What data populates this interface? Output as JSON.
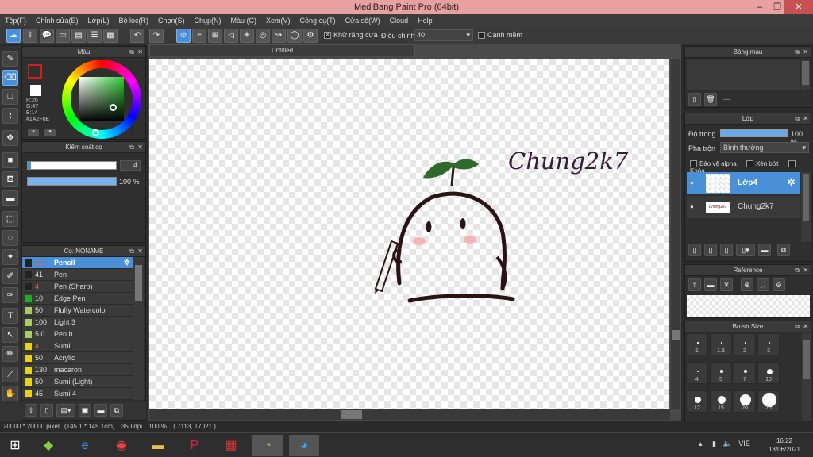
{
  "window": {
    "title": "MediBang Paint Pro (64bit)",
    "minimize": "‒",
    "maximize": "❐",
    "close": "✕"
  },
  "menu": [
    "Tệp(F)",
    "Chỉnh sửa(E)",
    "Lớp(L)",
    "Bộ lọc(R)",
    "Chọn(S)",
    "Chụp(N)",
    "Màu (C)",
    "Xem(V)",
    "Công cụ(T)",
    "Cửa sổ(W)",
    "Cloud",
    "Help"
  ],
  "toolbar": {
    "antialias_label": "Khử răng cưa",
    "adjust_label": "Điều chỉnh",
    "adjust_value": "40",
    "soft_edge_label": "Cạnh mềm"
  },
  "color_panel": {
    "title": "Màu",
    "r": "R:26",
    "g": "G:47",
    "b": "B:14",
    "hex": "#1A2F0E"
  },
  "brush_control": {
    "title": "Kiểm soát cọ",
    "size_value": "4",
    "opacity_value": "100 %"
  },
  "brush_list": {
    "title": "Cọ: NONAME",
    "items": [
      {
        "size": "12",
        "name": "Pencil",
        "color": "#222222",
        "selected": true
      },
      {
        "size": "41",
        "name": "Pen",
        "color": "#222222"
      },
      {
        "size": "4",
        "name": "Pen (Sharp)",
        "color": "#222222"
      },
      {
        "size": "10",
        "name": "Edge Pen",
        "color": "#22aa22"
      },
      {
        "size": "50",
        "name": "Fluffy Watercolor",
        "color": "#aacc66"
      },
      {
        "size": "100",
        "name": "Light 3",
        "color": "#aacc66"
      },
      {
        "size": "5.0",
        "name": " Pen b",
        "color": "#aacc66"
      },
      {
        "size": "4",
        "name": "Sumi",
        "color": "#e8d020"
      },
      {
        "size": "50",
        "name": "Acrylic",
        "color": "#e8d020"
      },
      {
        "size": "130",
        "name": "macaron",
        "color": "#e8d020"
      },
      {
        "size": "50",
        "name": "Sumi (Light)",
        "color": "#e8d020"
      },
      {
        "size": "45",
        "name": "Sumi 4",
        "color": "#e8d020"
      }
    ]
  },
  "document": {
    "tab": "Untitled",
    "signature": "Chung2k7"
  },
  "palette_panel": {
    "title": "Bảng màu",
    "dash": "---"
  },
  "layer_panel": {
    "title": "Lớp",
    "opacity_label": "Độ trong",
    "opacity_value": "100 %",
    "blend_label": "Pha trộn",
    "blend_value": "Bình thường",
    "protect_alpha": "Bảo vệ alpha",
    "clip": "Xén bớt",
    "lock": "Khóa",
    "layers": [
      {
        "name": "Lớp4",
        "selected": true
      },
      {
        "name": "Chung2k7",
        "thumb_text": "Chung2k7"
      }
    ]
  },
  "reference_panel": {
    "title": "Reference"
  },
  "brush_size_panel": {
    "title": "Brush Size",
    "sizes": [
      "1",
      "1.5",
      "2",
      "3",
      "4",
      "5",
      "7",
      "10",
      "12",
      "15",
      "20",
      "25"
    ]
  },
  "status_bar": {
    "canvas_size": "20000 * 20000 pixel",
    "print_size": "(145.1 * 145.1cm)",
    "dpi": "350 dpi",
    "zoom": "100 %",
    "coords": "( 7113, 17021 )"
  },
  "taskbar": {
    "lang": "VIE",
    "time": "16:22",
    "date": "13/06/2021"
  }
}
